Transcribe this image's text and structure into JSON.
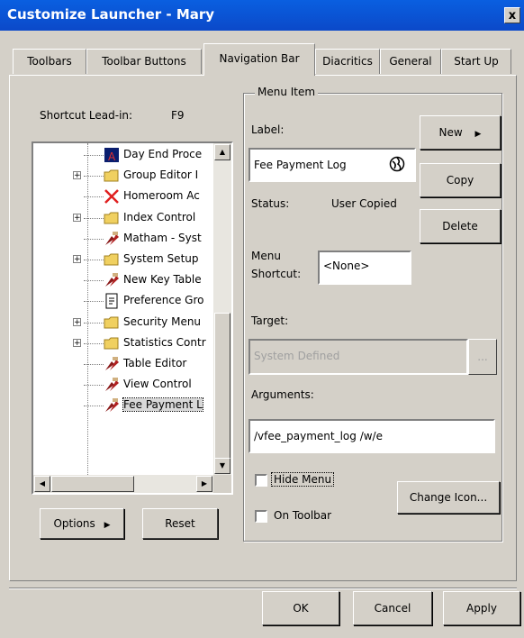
{
  "window": {
    "title": "Customize Launcher - Mary",
    "close_glyph": "x"
  },
  "tabs": [
    "Toolbars",
    "Toolbar Buttons",
    "Navigation Bar",
    "Diacritics",
    "General",
    "Start Up"
  ],
  "left": {
    "lead_in_label": "Shortcut Lead-in:",
    "lead_in_value": "F9",
    "tree_items": [
      {
        "label": "Day End Proce",
        "icon": "day-end-icon",
        "expander": false
      },
      {
        "label": "Group Editor I",
        "icon": "folder-icon",
        "expander": true
      },
      {
        "label": "Homeroom Ac",
        "icon": "red-x-icon",
        "expander": false
      },
      {
        "label": "Index Control",
        "icon": "folder-icon",
        "expander": true
      },
      {
        "label": "Matham - Syst",
        "icon": "tools-icon",
        "expander": false
      },
      {
        "label": "System Setup",
        "icon": "folder-icon",
        "expander": true
      },
      {
        "label": "New Key Table",
        "icon": "tools-icon",
        "expander": false
      },
      {
        "label": "Preference Gro",
        "icon": "document-icon",
        "expander": false
      },
      {
        "label": "Security Menu",
        "icon": "folder-icon",
        "expander": true
      },
      {
        "label": "Statistics Contr",
        "icon": "folder-icon",
        "expander": true
      },
      {
        "label": "Table Editor",
        "icon": "tools-icon",
        "expander": false
      },
      {
        "label": "View Control",
        "icon": "tools-icon",
        "expander": false
      },
      {
        "label": "Fee Payment L",
        "icon": "tools-icon",
        "expander": false,
        "selected": true
      }
    ],
    "options_label": "Options",
    "reset_label": "Reset"
  },
  "menu_item": {
    "group_title": "Menu Item",
    "label_caption": "Label:",
    "label_value": "Fee Payment Log",
    "status_caption": "Status:",
    "status_value": "User Copied",
    "shortcut_caption_1": "Menu",
    "shortcut_caption_2": "Shortcut:",
    "shortcut_value": "<None>",
    "target_caption": "Target:",
    "target_value": "System Defined",
    "browse_label": "...",
    "arguments_caption": "Arguments:",
    "arguments_value": "/vfee_payment_log /w/e",
    "hide_menu_label": "Hide Menu",
    "on_toolbar_label": "On Toolbar",
    "change_icon_label": "Change Icon...",
    "new_label": "New",
    "copy_label": "Copy",
    "delete_label": "Delete"
  },
  "footer": {
    "ok_label": "OK",
    "cancel_label": "Cancel",
    "apply_label": "Apply"
  }
}
